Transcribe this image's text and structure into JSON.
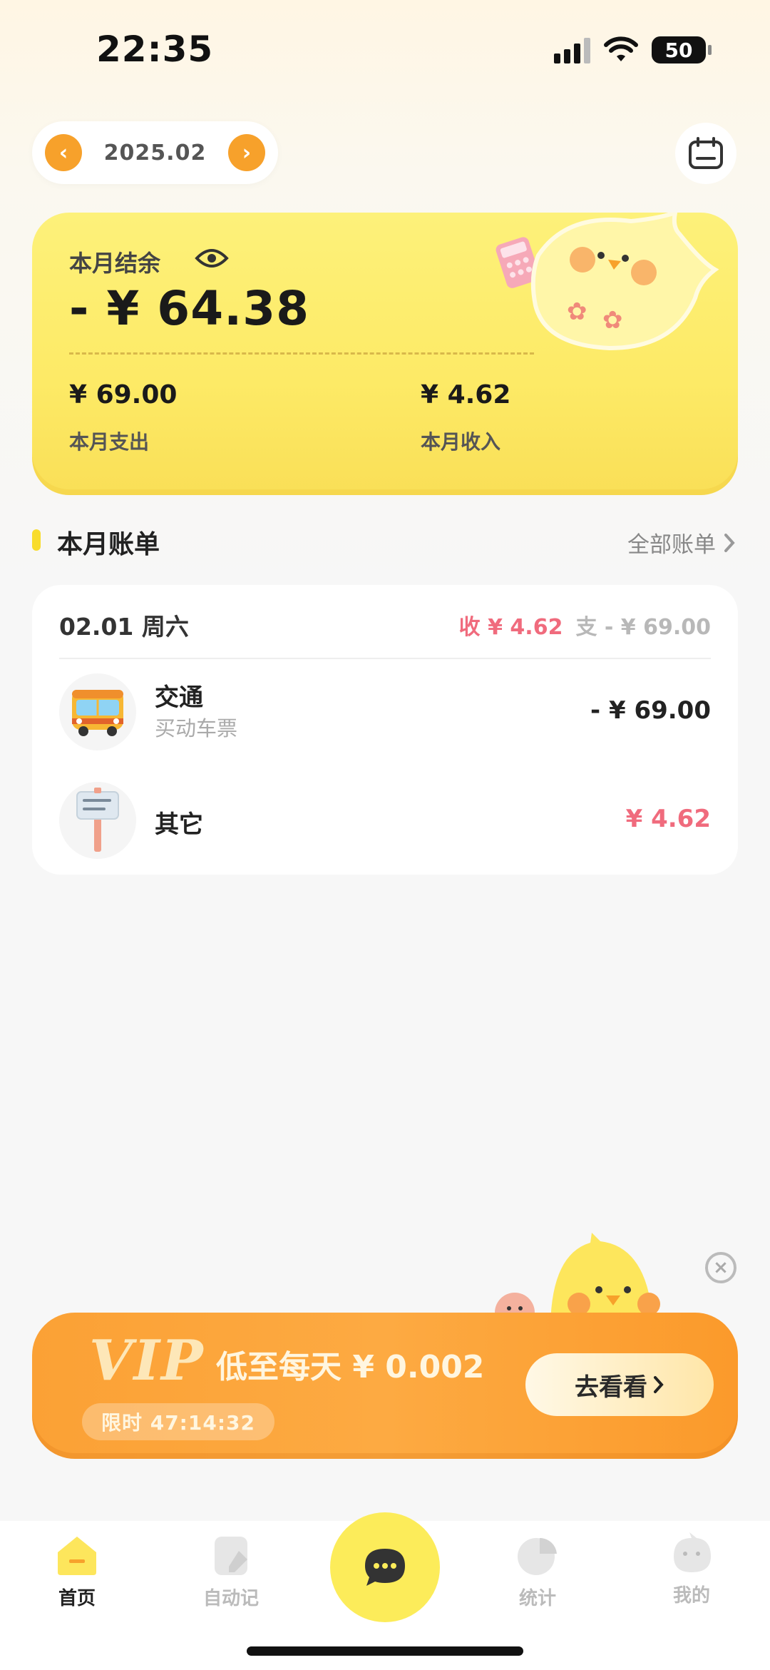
{
  "status_bar": {
    "time": "22:35",
    "battery": "50"
  },
  "header": {
    "month": "2025.02",
    "prev_icon": "chevron-left-icon",
    "next_icon": "chevron-right-icon",
    "calendar_icon": "calendar-icon"
  },
  "summary": {
    "balance_label": "本月结余",
    "balance": "- ¥ 64.38",
    "expense_value": "¥ 69.00",
    "expense_label": "本月支出",
    "income_value": "¥ 4.62",
    "income_label": "本月收入"
  },
  "bills": {
    "title": "本月账单",
    "all_link": "全部账单",
    "day": {
      "date": "02.01 周六",
      "income": "收 ¥ 4.62",
      "expense": "支 - ¥ 69.00",
      "items": [
        {
          "name": "交通",
          "note": "买动车票",
          "amount": "- ¥ 69.00",
          "icon": "bus-icon"
        },
        {
          "name": "其它",
          "note": "",
          "amount": "¥ 4.62",
          "icon": "signpost-icon"
        }
      ]
    }
  },
  "vip": {
    "logo": "VIP",
    "price": "低至每天 ¥ 0.002",
    "timer": "限时 47:14:32",
    "button": "去看看",
    "close": "×"
  },
  "tabbar": {
    "home": "首页",
    "auto": "自动记",
    "stats": "统计",
    "mine": "我的"
  },
  "colors": {
    "accent_orange": "#f7a12b",
    "card_yellow": "#fdf17a",
    "income_pink": "#f06b7d",
    "vip_orange": "#fba135"
  }
}
